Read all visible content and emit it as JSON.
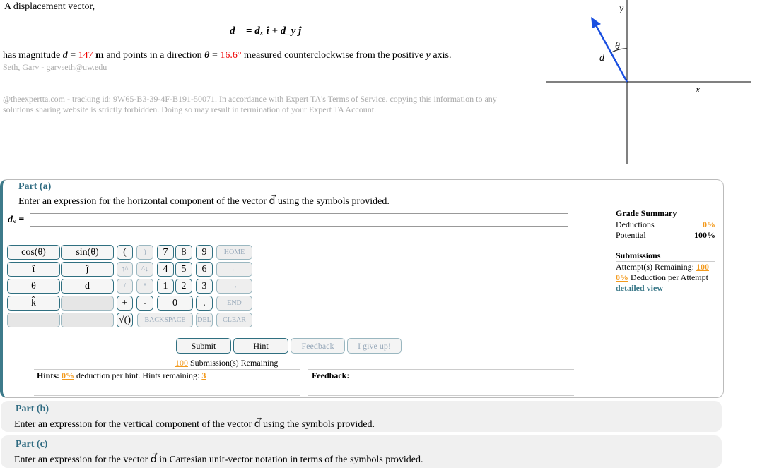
{
  "problem": {
    "intro": "A displacement vector,",
    "equation": "d⃗ = dₓ î + d_y ĵ",
    "magnitude_pre": "has magnitude ",
    "d_sym": "d",
    "eq": " = ",
    "magnitude": "147",
    "unit": " m",
    "direction_pre": " and points in a direction ",
    "theta_sym": "θ",
    "direction": "16.6°",
    "direction_post": " measured counterclockwise from the positive ",
    "axis": "y",
    "axis_post": " axis.",
    "student": "Seth, Garv - garvseth@uw.edu",
    "notice1": "@theexpertta.com - tracking id: 9W65-B3-39-4F-B191-50071. In accordance with Expert TA's Terms of Service. copying this information to any",
    "notice2": "solutions sharing website is strictly forbidden. Doing so may result in termination of your Expert TA Account."
  },
  "diagram": {
    "y_label": "y",
    "x_label": "x",
    "theta_label": "θ",
    "d_label": "d"
  },
  "part_a": {
    "title": "Part (a)",
    "prompt": "Enter an expression for the horizontal component of the vector d⃗ using the symbols provided.",
    "input_label": "dₓ =",
    "input_value": ""
  },
  "keypad": [
    "cos(θ)",
    "sin(θ)",
    "(",
    ")",
    "7",
    "8",
    "9",
    "HOME",
    "î",
    "ĵ",
    "↑^",
    "^↓",
    "4",
    "5",
    "6",
    "←",
    "θ",
    "d",
    "/",
    "*",
    "1",
    "2",
    "3",
    "→",
    "k̂",
    "",
    "+",
    "-",
    "0",
    ".",
    "END",
    "",
    "",
    "√()",
    "BACKSPACE",
    "DEL",
    "CLEAR"
  ],
  "buttons": {
    "submit": "Submit",
    "hint": "Hint",
    "feedback": "Feedback",
    "give_up": "I give up!"
  },
  "submissions_remaining": "100",
  "submissions_text": " Submission(s) Remaining",
  "hints": {
    "label": "Hints:",
    "pct": "0%",
    "text": " deduction per hint. Hints remaining: ",
    "remaining": "3"
  },
  "feedback_label": "Feedback:",
  "grade": {
    "title": "Grade Summary",
    "deductions_label": "Deductions",
    "deductions": "0%",
    "potential_label": "Potential",
    "potential": "100%",
    "submissions_title": "Submissions",
    "attempts_label": "Attempt(s) Remaining: ",
    "attempts": "100",
    "per_attempt": "0%",
    "per_attempt_label": " Deduction per Attempt",
    "detailed": "detailed view"
  },
  "part_b": {
    "title": "Part (b)",
    "prompt": "Enter an expression for the vertical component of the vector d⃗ using the symbols provided."
  },
  "part_c": {
    "title": "Part (c)",
    "prompt": "Enter an expression for the vector d⃗ in Cartesian unit-vector notation in terms of the symbols provided."
  },
  "colors": {
    "accent": "#2f6f80",
    "highlight": "#f39a1d",
    "error": "#e00000"
  }
}
